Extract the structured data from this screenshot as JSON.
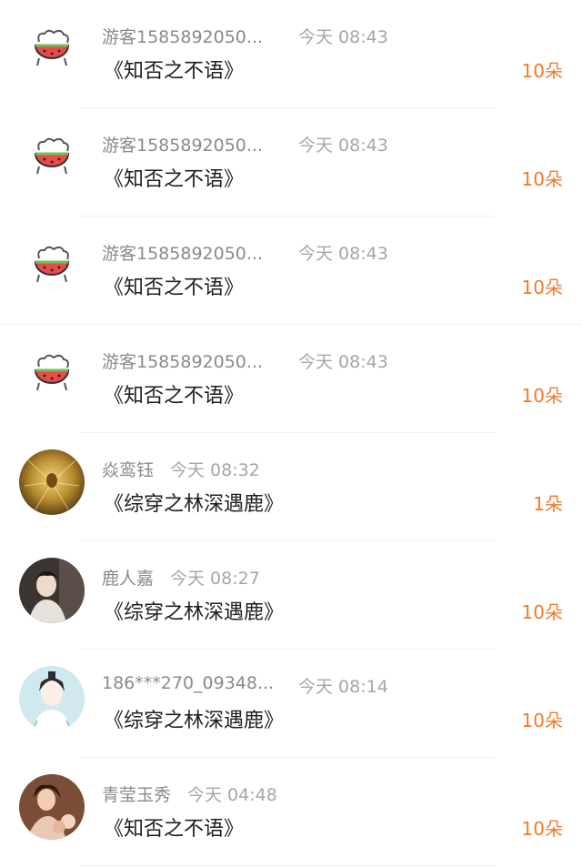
{
  "items": [
    {
      "name": "游客1585892050...",
      "time": "今天 08:43",
      "title": "《知否之不语》",
      "gift": "10朵",
      "avatar": "watermelon-bear-icon"
    },
    {
      "name": "游客1585892050...",
      "time": "今天 08:43",
      "title": "《知否之不语》",
      "gift": "10朵",
      "avatar": "watermelon-bear-icon"
    },
    {
      "name": "游客1585892050...",
      "time": "今天 08:43",
      "title": "《知否之不语》",
      "gift": "10朵",
      "avatar": "watermelon-bear-icon"
    },
    {
      "name": "游客1585892050...",
      "time": "今天 08:43",
      "title": "《知否之不语》",
      "gift": "10朵",
      "avatar": "watermelon-bear-icon"
    },
    {
      "name": "焱鸾钰",
      "time": "今天 08:32",
      "title": "《综穿之林深遇鹿》",
      "gift": "1朵",
      "avatar": "golden-figure-avatar"
    },
    {
      "name": "鹿人嘉",
      "time": "今天 08:27",
      "title": "《综穿之林深遇鹿》",
      "gift": "10朵",
      "avatar": "costume-portrait-avatar"
    },
    {
      "name": "186***270_09348...",
      "time": "今天 08:14",
      "title": "《综穿之林深遇鹿》",
      "gift": "10朵",
      "avatar": "anime-character-avatar"
    },
    {
      "name": "青莹玉秀",
      "time": "今天 04:48",
      "title": "《知否之不语》",
      "gift": "10朵",
      "avatar": "photo-portrait-avatar"
    }
  ],
  "colors": {
    "accent": "#f07b2a",
    "name": "#8a8a8a",
    "time": "#a6a6a6",
    "title": "#1f1f1f"
  }
}
